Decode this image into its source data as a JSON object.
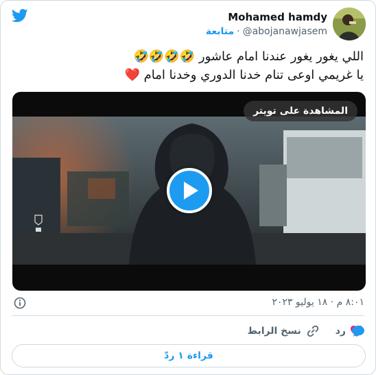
{
  "author": {
    "display_name": "Mohamed hamdy",
    "handle": "@abojanawjasem",
    "separator": "·",
    "follow_label": "متابعة"
  },
  "tweet": {
    "line1": "اللي يغور يغور عندنا امام عاشور 🤣🤣🤣🤣",
    "line2": "يا غريمي اوعى تنام خدنا الدوري وخدنا امام ❤️"
  },
  "media": {
    "watch_label": "المشاهدة على تويتر",
    "play_icon": "play-icon"
  },
  "meta": {
    "timestamp": "٨:٠١ م · ١٨ يوليو ٢٠٢٣"
  },
  "actions": {
    "reply_label": "رد",
    "copy_link_label": "نسخ الرابط"
  },
  "read_replies_label": "قراءة ١ ردّ",
  "colors": {
    "accent": "#1d9bf0",
    "heart": "#f91880",
    "secondary_text": "#536471",
    "border": "#cfd9de"
  }
}
